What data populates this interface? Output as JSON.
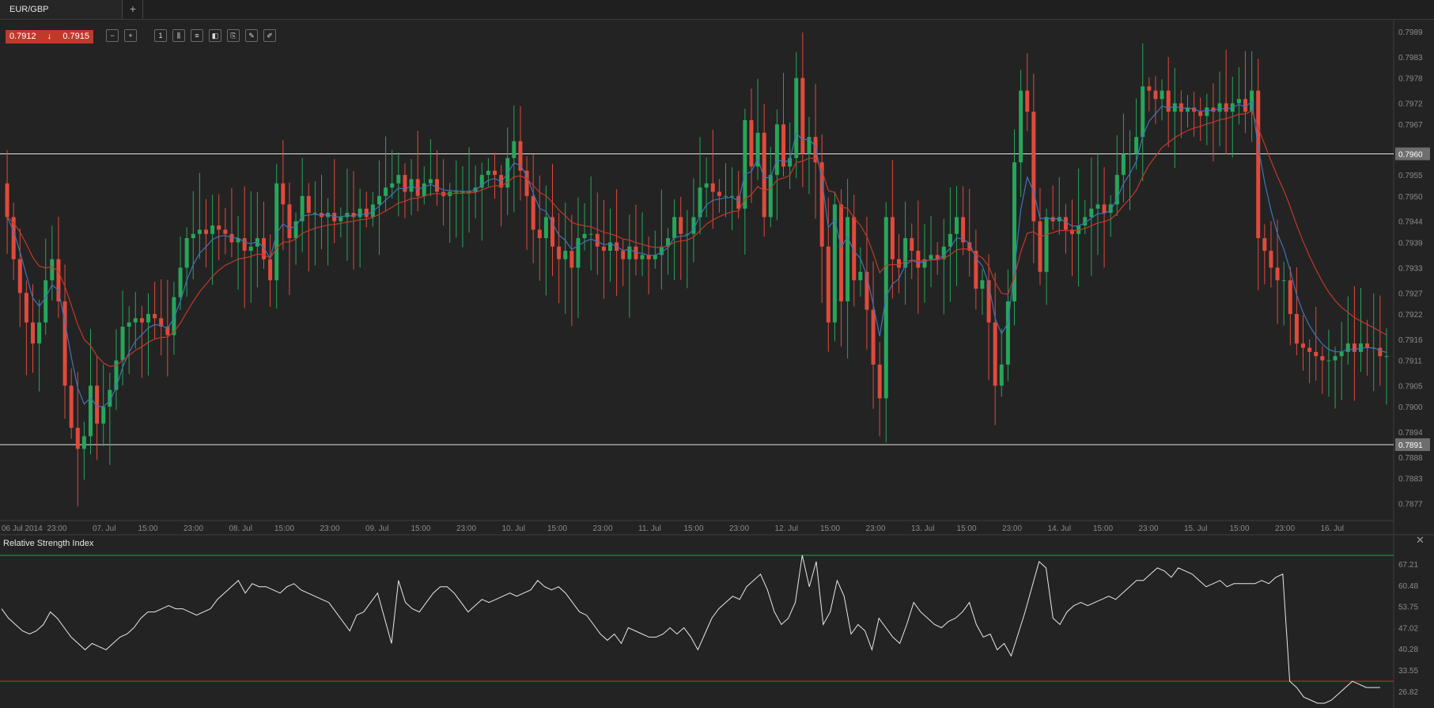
{
  "tab": {
    "symbol": "EUR/GBP",
    "add_label": "+"
  },
  "quote": {
    "bid": "0.7912",
    "ask": "0.7915",
    "direction_icon": "arrow-down-icon"
  },
  "toolbar": {
    "tools": [
      {
        "name": "zoom-out-icon",
        "glyph": "−"
      },
      {
        "name": "zoom-in-icon",
        "glyph": "+"
      },
      {
        "name": "timeframe-button",
        "glyph": "1"
      },
      {
        "name": "chart-type-icon",
        "glyph": "⫼"
      },
      {
        "name": "indicators-icon",
        "glyph": "≡"
      },
      {
        "name": "chart-settings-icon",
        "glyph": "◧"
      },
      {
        "name": "template-icon",
        "glyph": "⎘"
      },
      {
        "name": "edit-icon",
        "glyph": "✎"
      },
      {
        "name": "draw-icon",
        "glyph": "✐"
      }
    ]
  },
  "colors": {
    "bull": "#26a65b",
    "bear": "#e04a3c",
    "ma_fast": "#3e74b8",
    "ma_slow": "#c0392b",
    "line": "#e8e8e8",
    "rsi_upper": "#2e9e52",
    "rsi_lower": "#c0392b"
  },
  "chart_data": [
    {
      "type": "candlestick",
      "title": "EUR/GBP",
      "ylim": [
        0.7873,
        0.7992
      ],
      "y_ticks": [
        "0.7989",
        "0.7983",
        "0.7978",
        "0.7972",
        "0.7967",
        "0.7960",
        "0.7955",
        "0.7950",
        "0.7944",
        "0.7939",
        "0.7933",
        "0.7927",
        "0.7922",
        "0.7916",
        "0.7911",
        "0.7905",
        "0.7900",
        "0.7894",
        "0.7891",
        "0.7888",
        "0.7883",
        "0.7877"
      ],
      "x_labels": [
        "06 Jul 2014",
        "23:00",
        "07. Jul",
        "15:00",
        "23:00",
        "08. Jul",
        "15:00",
        "23:00",
        "09. Jul",
        "15:00",
        "23:00",
        "10. Jul",
        "15:00",
        "23:00",
        "11. Jul",
        "15:00",
        "23:00",
        "12. Jul",
        "15:00",
        "23:00",
        "13. Jul",
        "15:00",
        "23:00",
        "14. Jul",
        "15:00",
        "23:00",
        "15. Jul",
        "15:00",
        "23:00",
        "16. Jul"
      ],
      "horizontal_levels": [
        {
          "value": 0.796,
          "label": "0.7960"
        },
        {
          "value": 0.7891,
          "label": "0.7891"
        }
      ],
      "closes": [
        0.7945,
        0.7935,
        0.7927,
        0.792,
        0.7915,
        0.792,
        0.793,
        0.7935,
        0.7925,
        0.7905,
        0.7895,
        0.789,
        0.7893,
        0.7905,
        0.7896,
        0.79,
        0.7904,
        0.7911,
        0.7919,
        0.792,
        0.7921,
        0.792,
        0.7922,
        0.7921,
        0.7919,
        0.7917,
        0.7926,
        0.7933,
        0.794,
        0.7941,
        0.7942,
        0.7941,
        0.7943,
        0.7942,
        0.7941,
        0.7939,
        0.794,
        0.7937,
        0.7938,
        0.794,
        0.7935,
        0.793,
        0.7953,
        0.7948,
        0.794,
        0.7944,
        0.795,
        0.7946,
        0.7946,
        0.7945,
        0.7946,
        0.7944,
        0.7945,
        0.7946,
        0.7945,
        0.7947,
        0.7945,
        0.7948,
        0.795,
        0.7952,
        0.7953,
        0.7955,
        0.7951,
        0.7954,
        0.795,
        0.7953,
        0.7954,
        0.7951,
        0.795,
        0.7951,
        0.7951,
        0.7951,
        0.7951,
        0.7952,
        0.7955,
        0.7956,
        0.7955,
        0.7952,
        0.7959,
        0.7963,
        0.7956,
        0.795,
        0.7942,
        0.794,
        0.7945,
        0.7938,
        0.7935,
        0.7937,
        0.7933,
        0.794,
        0.7941,
        0.7941,
        0.7938,
        0.7937,
        0.7939,
        0.7937,
        0.7935,
        0.7938,
        0.7935,
        0.7936,
        0.7935,
        0.7936,
        0.7938,
        0.794,
        0.7945,
        0.7941,
        0.7941,
        0.7945,
        0.7952,
        0.7953,
        0.7951,
        0.795,
        0.795,
        0.795,
        0.7947,
        0.7968,
        0.7957,
        0.7965,
        0.7945,
        0.7955,
        0.7967,
        0.7957,
        0.7959,
        0.7978,
        0.796,
        0.7964,
        0.7958,
        0.7938,
        0.792,
        0.7948,
        0.7925,
        0.7945,
        0.793,
        0.7932,
        0.7923,
        0.791,
        0.7902,
        0.7945,
        0.7935,
        0.7933,
        0.794,
        0.7937,
        0.7933,
        0.7935,
        0.7936,
        0.7935,
        0.7938,
        0.7941,
        0.7945,
        0.7939,
        0.7937,
        0.7928,
        0.793,
        0.792,
        0.7905,
        0.791,
        0.7925,
        0.7958,
        0.7975,
        0.797,
        0.7944,
        0.7932,
        0.7945,
        0.7944,
        0.7945,
        0.7942,
        0.7941,
        0.7943,
        0.7945,
        0.7947,
        0.7948,
        0.7946,
        0.7948,
        0.7955,
        0.796,
        0.796,
        0.7964,
        0.7976,
        0.7975,
        0.7973,
        0.7975,
        0.797,
        0.7972,
        0.797,
        0.7971,
        0.797,
        0.7969,
        0.7971,
        0.797,
        0.7972,
        0.797,
        0.7972,
        0.7973,
        0.797,
        0.7975,
        0.794,
        0.7937,
        0.7933,
        0.793,
        0.793,
        0.7922,
        0.7915,
        0.7914,
        0.7913,
        0.7912,
        0.7911,
        0.7911,
        0.7912,
        0.7913,
        0.7915,
        0.7913,
        0.7915,
        0.7914,
        0.7914,
        0.7912,
        0.7912
      ],
      "series": [
        {
          "name": "ma_fast",
          "period": 5
        },
        {
          "name": "ma_slow",
          "period": 14
        }
      ]
    },
    {
      "type": "line",
      "title": "Relative Strength Index",
      "ylim": [
        22,
        73
      ],
      "y_ticks": [
        "67.21",
        "60.48",
        "53.75",
        "47.02",
        "40.28",
        "33.55",
        "26.82"
      ],
      "levels": [
        70,
        30
      ],
      "values": [
        53,
        50,
        48,
        46,
        45,
        46,
        48,
        52,
        50,
        47,
        44,
        42,
        40,
        42,
        41,
        40,
        42,
        44,
        45,
        47,
        50,
        52,
        52,
        53,
        54,
        53,
        53,
        52,
        51,
        52,
        53,
        56,
        58,
        60,
        62,
        58,
        61,
        60,
        60,
        59,
        58,
        60,
        61,
        59,
        58,
        57,
        56,
        55,
        52,
        49,
        46,
        51,
        52,
        55,
        58,
        50,
        42,
        62,
        55,
        53,
        52,
        55,
        58,
        60,
        60,
        58,
        55,
        52,
        54,
        56,
        55,
        56,
        57,
        58,
        57,
        58,
        59,
        62,
        60,
        59,
        60,
        58,
        55,
        52,
        51,
        48,
        45,
        43,
        45,
        42,
        47,
        46,
        45,
        44,
        44,
        45,
        47,
        45,
        47,
        44,
        40,
        45,
        50,
        53,
        55,
        57,
        56,
        60,
        62,
        64,
        59,
        52,
        48,
        50,
        55,
        70,
        60,
        68,
        48,
        52,
        62,
        57,
        45,
        48,
        46,
        40,
        50,
        47,
        44,
        42,
        48,
        55,
        52,
        50,
        48,
        47,
        49,
        50,
        52,
        55,
        48,
        44,
        45,
        40,
        42,
        38,
        45,
        52,
        60,
        68,
        66,
        50,
        48,
        52,
        54,
        55,
        54,
        55,
        56,
        57,
        56,
        58,
        60,
        62,
        62,
        64,
        66,
        65,
        63,
        66,
        65,
        64,
        62,
        60,
        61,
        62,
        60,
        61,
        61,
        61,
        61,
        62,
        61,
        63,
        64,
        30,
        28,
        25,
        24,
        23,
        23,
        24,
        26,
        28,
        30,
        29,
        28,
        28,
        28
      ]
    }
  ]
}
